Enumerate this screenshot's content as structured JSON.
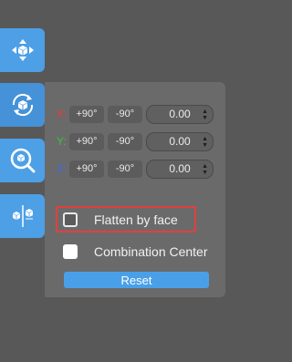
{
  "toolbar": {
    "items": [
      {
        "name": "move-tool",
        "icon": "move-arrows-icon"
      },
      {
        "name": "rotate-tool",
        "icon": "rotate-cube-icon",
        "active": true
      },
      {
        "name": "scale-tool",
        "icon": "scale-magnify-icon"
      },
      {
        "name": "mirror-tool",
        "icon": "mirror-cubes-icon"
      }
    ]
  },
  "rotate_panel": {
    "rows": [
      {
        "axis": "X:",
        "plus": "+90°",
        "minus": "-90°",
        "value": "0.00"
      },
      {
        "axis": "Y:",
        "plus": "+90°",
        "minus": "-90°",
        "value": "0.00"
      },
      {
        "axis": "Z:",
        "plus": "+90°",
        "minus": "-90°",
        "value": "0.00"
      }
    ],
    "flatten_label": "Flatten by face",
    "combination_label": "Combination Center",
    "reset_label": "Reset"
  },
  "colors": {
    "accent": "#4d9fe6",
    "panel": "#6a6a6a",
    "background": "#585858",
    "highlight": "#e04040",
    "axis_x": "#e63b3b",
    "axis_y": "#3ac43a",
    "axis_z": "#3c6df0"
  }
}
